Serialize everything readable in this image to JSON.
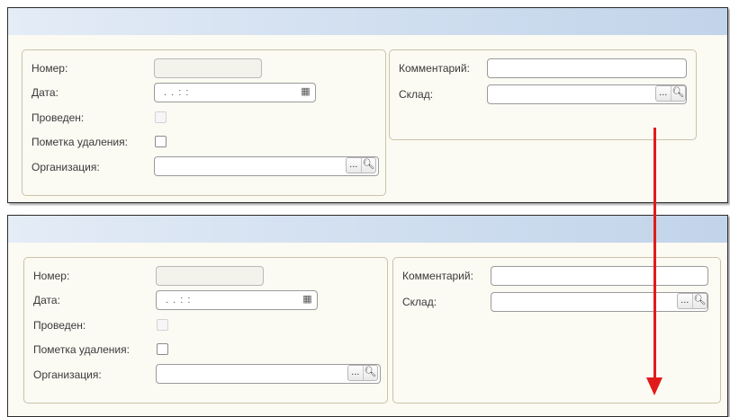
{
  "forms": [
    {
      "number": {
        "label": "Номер:",
        "value": ""
      },
      "date": {
        "label": "Дата:",
        "value": ". .   : :"
      },
      "posted": {
        "label": "Проведен:",
        "checked": false
      },
      "deletion_mark": {
        "label": "Пометка удаления:",
        "checked": false
      },
      "organization": {
        "label": "Организация:",
        "value": "",
        "select_label": "...",
        "open_icon": "magnifier-icon"
      },
      "comment": {
        "label": "Комментарий:",
        "value": ""
      },
      "warehouse": {
        "label": "Склад:",
        "value": "",
        "select_label": "...",
        "open_icon": "magnifier-icon"
      }
    },
    {
      "number": {
        "label": "Номер:",
        "value": ""
      },
      "date": {
        "label": "Дата:",
        "value": ". .   : :"
      },
      "posted": {
        "label": "Проведен:",
        "checked": false
      },
      "deletion_mark": {
        "label": "Пометка удаления:",
        "checked": false
      },
      "organization": {
        "label": "Организация:",
        "value": "",
        "select_label": "...",
        "open_icon": "magnifier-icon"
      },
      "comment": {
        "label": "Комментарий:",
        "value": ""
      },
      "warehouse": {
        "label": "Склад:",
        "value": "",
        "select_label": "...",
        "open_icon": "magnifier-icon"
      }
    }
  ],
  "colors": {
    "arrow": "#e11b1b",
    "titlebar": "#d1dff0",
    "form_background": "#fbfaf3",
    "group_border": "#c9c4a8"
  },
  "annotation": {
    "icon": "red-arrow-down-icon"
  }
}
